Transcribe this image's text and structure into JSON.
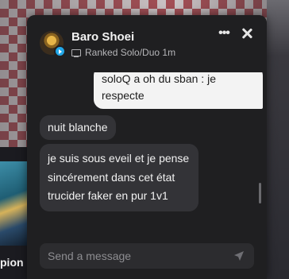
{
  "background": {
    "champion_label": "pion"
  },
  "chat": {
    "user": {
      "name": "Baro Shoei",
      "status": "Ranked Solo/Duo 1m",
      "status_color": "#22a7e8"
    },
    "header_icons": {
      "more": "more-options-icon",
      "close": "close-icon",
      "status": "monitor-icon"
    },
    "messages": [
      {
        "direction": "outgoing",
        "text": "soloQ a oh du sban : je respecte"
      },
      {
        "direction": "incoming",
        "text": "nuit blanche"
      },
      {
        "direction": "incoming",
        "text": "je suis sous eveil et je pense sincérement dans cet état trucider faker en pur 1v1"
      }
    ],
    "input": {
      "placeholder": "Send a message",
      "value": ""
    },
    "colors": {
      "window_bg": "#1f1f21",
      "incoming_bubble": "#333337",
      "outgoing_bubble": "#f3f3f3"
    }
  }
}
